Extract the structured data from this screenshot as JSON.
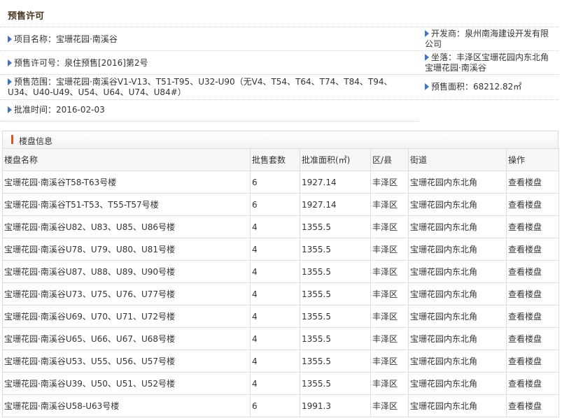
{
  "page_title": "预售许可",
  "permit": {
    "project_name": "项目名称：宝珊花园·南溪谷",
    "developer_line1": "开发商：泉州南海建设开发有限",
    "developer_line2": "公司",
    "permit_no": "预售许可号：泉住预售[2016]第2号",
    "location_line1": "坐落：丰泽区宝珊花园内东北角",
    "location_line2": "宝珊花园·南溪谷",
    "scope_line1": "预售范围：宝珊花园·南溪谷V1-V13、T51-T95、U32-U90（无V4、T54、T64、T74、T84、T94、",
    "scope_line2": "U34、U40-U49、U54、U64、U74、U84#）",
    "area": "预售面积：68212.82㎡",
    "approval_date": "批准时间：2016-02-03"
  },
  "listing": {
    "section_title": "楼盘信息",
    "columns": [
      "楼盘名称",
      "批售套数",
      "批准面积(㎡)",
      "区/县",
      "街道",
      "操作"
    ],
    "rows": [
      {
        "name": "宝珊花园·南溪谷T58-T63号楼",
        "units": "6",
        "area": "1927.14",
        "district": "丰泽区",
        "street": "宝珊花园内东北角",
        "action": "查看楼盘"
      },
      {
        "name": "宝珊花园·南溪谷T51-T53、T55-T57号楼",
        "units": "6",
        "area": "1927.14",
        "district": "丰泽区",
        "street": "宝珊花园内东北角",
        "action": "查看楼盘"
      },
      {
        "name": "宝珊花园·南溪谷U82、U83、U85、U86号楼",
        "units": "4",
        "area": "1355.5",
        "district": "丰泽区",
        "street": "宝珊花园内东北角",
        "action": "查看楼盘"
      },
      {
        "name": "宝珊花园·南溪谷U78、U79、U80、U81号楼",
        "units": "4",
        "area": "1355.5",
        "district": "丰泽区",
        "street": "宝珊花园内东北角",
        "action": "查看楼盘"
      },
      {
        "name": "宝珊花园·南溪谷U87、U88、U89、U90号楼",
        "units": "4",
        "area": "1355.5",
        "district": "丰泽区",
        "street": "宝珊花园内东北角",
        "action": "查看楼盘"
      },
      {
        "name": "宝珊花园·南溪谷U73、U75、U76、U77号楼",
        "units": "4",
        "area": "1355.5",
        "district": "丰泽区",
        "street": "宝珊花园内东北角",
        "action": "查看楼盘"
      },
      {
        "name": "宝珊花园·南溪谷U69、U70、U71、U72号楼",
        "units": "4",
        "area": "1355.5",
        "district": "丰泽区",
        "street": "宝珊花园内东北角",
        "action": "查看楼盘"
      },
      {
        "name": "宝珊花园·南溪谷U65、U66、U67、U68号楼",
        "units": "4",
        "area": "1355.5",
        "district": "丰泽区",
        "street": "宝珊花园内东北角",
        "action": "查看楼盘"
      },
      {
        "name": "宝珊花园·南溪谷U53、U55、U56、U57号楼",
        "units": "4",
        "area": "1355.5",
        "district": "丰泽区",
        "street": "宝珊花园内东北角",
        "action": "查看楼盘"
      },
      {
        "name": "宝珊花园·南溪谷U39、U50、U51、U52号楼",
        "units": "4",
        "area": "1355.5",
        "district": "丰泽区",
        "street": "宝珊花园内东北角",
        "action": "查看楼盘"
      },
      {
        "name": "宝珊花园·南溪谷U58-U63号楼",
        "units": "6",
        "area": "1991.3",
        "district": "丰泽区",
        "street": "宝珊花园内东北角",
        "action": "查看楼盘"
      }
    ]
  },
  "colors": {
    "arrow": "#3b75c2",
    "header_accent": "#e05020"
  }
}
